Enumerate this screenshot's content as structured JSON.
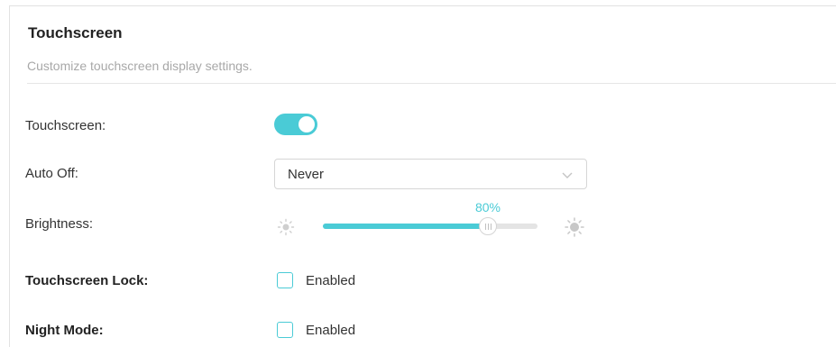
{
  "header": {
    "title": "Touchscreen",
    "subtitle": "Customize touchscreen display settings."
  },
  "touchscreen": {
    "label": "Touchscreen:",
    "enabled": true
  },
  "auto_off": {
    "label": "Auto Off:",
    "value": "Never"
  },
  "brightness": {
    "label": "Brightness:",
    "value_text": "80%",
    "value": 0.8
  },
  "touchscreen_lock": {
    "label": "Touchscreen Lock:",
    "option_label": "Enabled",
    "checked": false
  },
  "night_mode": {
    "label": "Night Mode:",
    "option_label": "Enabled",
    "checked": false
  },
  "colors": {
    "accent": "#4acbd6",
    "border": "#d6d6d6",
    "muted_text": "#a8a8a8"
  },
  "icons": {
    "dropdown": "chevron-down-icon",
    "brightness_low": "sun-low-icon",
    "brightness_high": "sun-high-icon"
  }
}
